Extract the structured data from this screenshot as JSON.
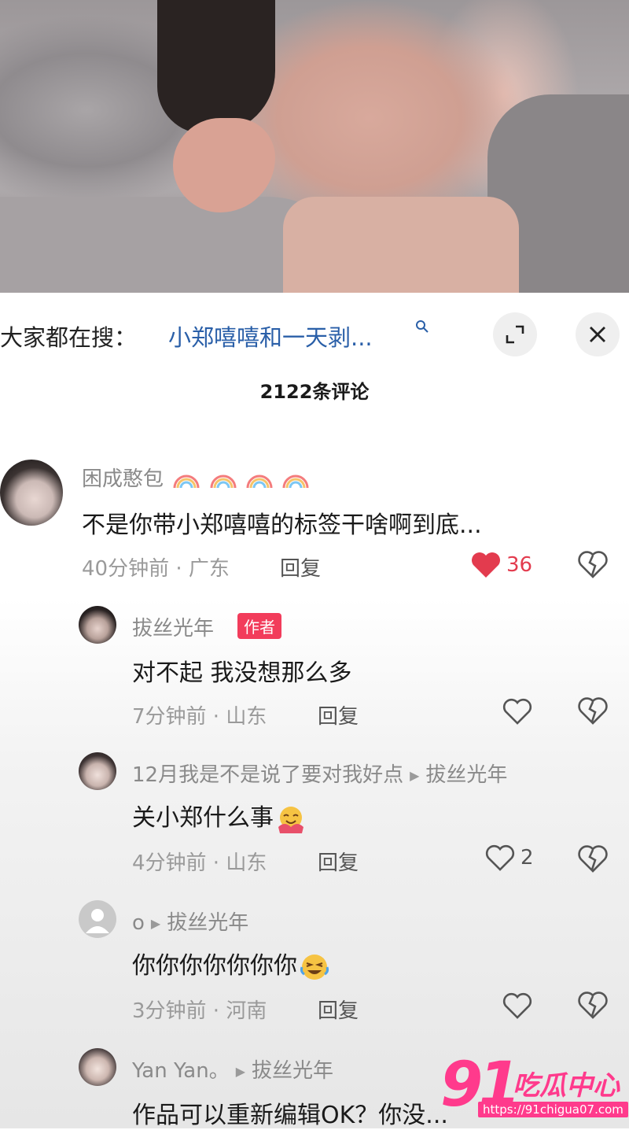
{
  "search_bar": {
    "prefix": "大家都在搜：",
    "term": "小郑嘻嘻和一天剥...",
    "search_icon": "search-icon",
    "expand_icon": "expand-icon",
    "close_icon": "close-icon"
  },
  "comment_count": "2122条评论",
  "colors": {
    "link_blue": "#2a5fa8",
    "like_red": "#e33b4e",
    "author_badge": "#f23c5b",
    "watermark_pink": "#ff3a8c"
  },
  "comments": [
    {
      "username": "困成憨包",
      "text": "不是你带小郑嘻嘻的标签干啥啊到底...",
      "meta": "40分钟前 · 广东",
      "reply": "回复",
      "likes": "36",
      "liked": true
    },
    {
      "username": "拔丝光年",
      "badge": "作者",
      "text": "对不起 我没想那么多",
      "meta": "7分钟前 · 山东",
      "reply": "回复"
    },
    {
      "username": "12月我是不是说了要对我好点",
      "reply_to": "拔丝光年",
      "text": "关小郑什么事",
      "meta": "4分钟前 · 山东",
      "reply": "回复",
      "likes": "2"
    },
    {
      "username": "o",
      "reply_to": "拔丝光年",
      "text": "你你你你你你你",
      "meta": "3分钟前 · 河南",
      "reply": "回复"
    },
    {
      "username": "Yan Yan。",
      "reply_to": "拔丝光年",
      "text": "作品可以重新编辑OK？你没..."
    }
  ],
  "watermark": {
    "number": "91",
    "name": "吃瓜中心",
    "url": "https://91chigua07.com"
  }
}
